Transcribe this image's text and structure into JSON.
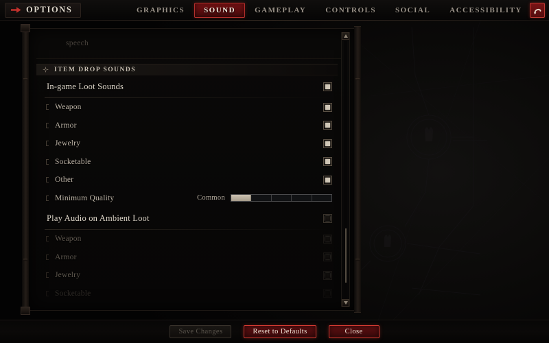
{
  "header": {
    "logo_icon": "right-arrow-icon",
    "title": "OPTIONS",
    "nav": [
      {
        "label": "GRAPHICS",
        "active": false
      },
      {
        "label": "SOUND",
        "active": true
      },
      {
        "label": "GAMEPLAY",
        "active": false
      },
      {
        "label": "CONTROLS",
        "active": false
      },
      {
        "label": "SOCIAL",
        "active": false
      },
      {
        "label": "ACCESSIBILITY",
        "active": false
      }
    ],
    "back_icon": "back-arrow-icon"
  },
  "panel": {
    "scrolled_out_label": "speech",
    "section": {
      "ornament_icon": "diamond-ornament-icon",
      "title": "ITEM DROP SOUNDS"
    },
    "groups": [
      {
        "header": {
          "label": "In-game Loot Sounds",
          "checked": true
        },
        "rows": [
          {
            "label": "Weapon",
            "type": "checkbox",
            "checked": true
          },
          {
            "label": "Armor",
            "type": "checkbox",
            "checked": true
          },
          {
            "label": "Jewelry",
            "type": "checkbox",
            "checked": true
          },
          {
            "label": "Socketable",
            "type": "checkbox",
            "checked": true
          },
          {
            "label": "Other",
            "type": "checkbox",
            "checked": true
          },
          {
            "label": "Minimum Quality",
            "type": "slider",
            "value_label": "Common",
            "segments": 5,
            "filled": 1
          }
        ]
      },
      {
        "header": {
          "label": "Play Audio on Ambient Loot",
          "checked": false
        },
        "rows": [
          {
            "label": "Weapon",
            "type": "checkbox",
            "checked": false,
            "disabled": true
          },
          {
            "label": "Armor",
            "type": "checkbox",
            "checked": false,
            "disabled": true
          },
          {
            "label": "Jewelry",
            "type": "checkbox",
            "checked": false,
            "disabled": true
          },
          {
            "label": "Socketable",
            "type": "checkbox",
            "checked": false,
            "disabled": true,
            "clipped": true
          }
        ]
      }
    ],
    "scrollbar": {
      "up_icon": "scroll-up-arrow-icon",
      "down_icon": "scroll-down-arrow-icon",
      "thumb_position_pct": 73,
      "thumb_size_pct": 21
    }
  },
  "footer": {
    "buttons": [
      {
        "label": "Save Changes",
        "style": "disabled"
      },
      {
        "label": "Reset to Defaults",
        "style": "danger"
      },
      {
        "label": "Close",
        "style": "danger"
      }
    ]
  },
  "colors": {
    "accent_red": "#b4302c",
    "tab_active_bg": "#5d0d0f",
    "text_primary": "#ded6c9",
    "text_muted": "#5d564d",
    "slider_fill": "#cdc3b2",
    "panel_bg": "#0a0908"
  }
}
